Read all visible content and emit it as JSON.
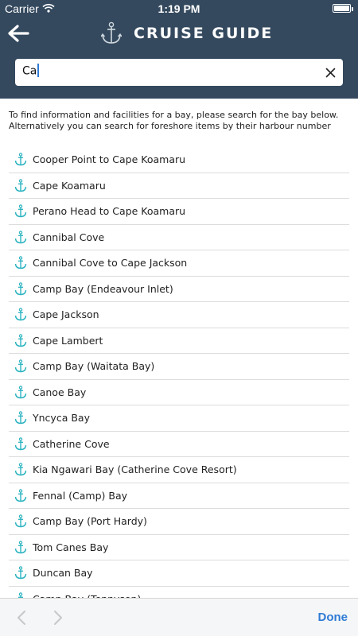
{
  "status_bar": {
    "carrier": "Carrier",
    "time": "1:19 PM",
    "wifi_icon": "wifi-icon",
    "battery_icon": "battery-icon"
  },
  "header": {
    "title": "CRUISE GUIDE",
    "back_icon": "arrow-left-icon",
    "logo_icon": "anchor-icon",
    "background": "#34495e"
  },
  "search": {
    "value": "Ca",
    "clear_icon": "close-icon"
  },
  "instructions": {
    "line1": "To find information and facilities for a bay, please search for the bay below.",
    "line2": "Alternatively you can search for foreshore items by their harbour number"
  },
  "results": {
    "icon": "anchor-icon",
    "icon_color": "#2bb3c0",
    "items": [
      "Cooper Point to Cape Koamaru",
      "Cape Koamaru",
      "Perano Head to Cape Koamaru",
      "Cannibal Cove",
      "Cannibal Cove to Cape Jackson",
      "Camp Bay (Endeavour Inlet)",
      "Cape Jackson",
      "Cape Lambert",
      "Camp Bay (Waitata Bay)",
      "Canoe Bay",
      "Yncyca Bay",
      "Catherine Cove",
      "Kia Ngawari Bay (Catherine Cove Resort)",
      "Fennal (Camp) Bay",
      "Camp Bay (Port Hardy)",
      "Tom Canes Bay",
      "Duncan Bay",
      "Camp Bay (Tennyson)"
    ]
  },
  "toolbar": {
    "done_label": "Done",
    "prev_icon": "chevron-left-icon",
    "next_icon": "chevron-right-icon",
    "accent": "#2f7bd6"
  }
}
